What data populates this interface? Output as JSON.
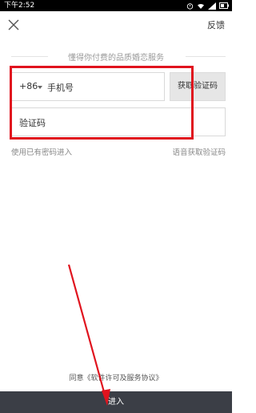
{
  "status_bar": {
    "time": "下午2:52"
  },
  "header": {
    "feedback_label": "反馈"
  },
  "login": {
    "subtitle": "懂得你付费的品质婚恋服务",
    "country_code": "+86",
    "phone_placeholder": "手机号",
    "get_code_label": "获取验证码",
    "code_placeholder": "验证码",
    "password_login_label": "使用已有密码进入",
    "voice_code_label": "语音获取验证码",
    "agreement_text": "同意《软件许可及服务协议》",
    "enter_label": "进入"
  },
  "annotation_colors": {
    "highlight": "#e0131e"
  },
  "icons": {
    "close": "close-icon",
    "wifi": "wifi-icon",
    "signal": "signal-icon",
    "battery": "battery-icon"
  }
}
